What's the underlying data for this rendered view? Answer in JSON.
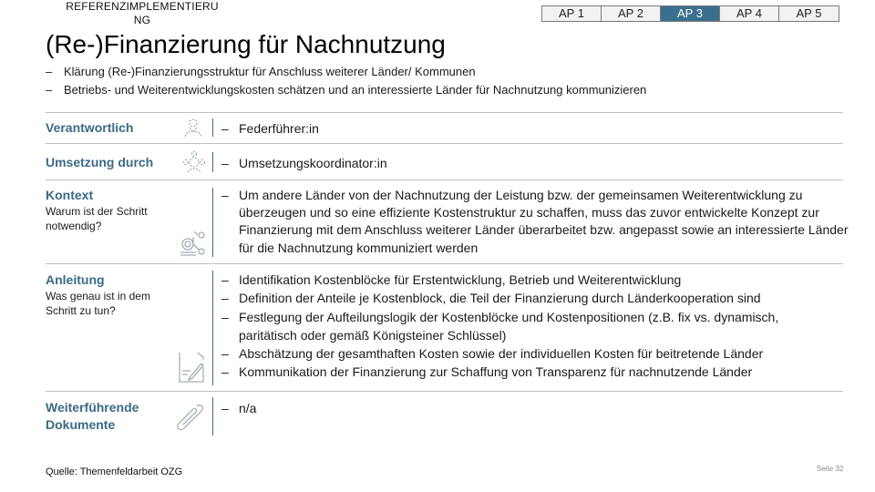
{
  "header": {
    "section": "REFERENZIMPLEMENTIERUNG",
    "section_line1": "REFERENZIMPLEMENTIERU",
    "section_line2": "NG",
    "tabs": [
      {
        "label": "AP 1",
        "active": false
      },
      {
        "label": "AP 2",
        "active": false
      },
      {
        "label": "AP 3",
        "active": true
      },
      {
        "label": "AP 4",
        "active": false
      },
      {
        "label": "AP 5",
        "active": false
      }
    ],
    "title": "(Re-)Finanzierung für Nachnutzung"
  },
  "intro": [
    "Klärung (Re-)Finanzierungsstruktur für Anschluss weiterer Länder/ Kommunen",
    "Betriebs- und Weiterentwicklungskosten schätzen und an interessierte Länder für Nachnutzung kommunizieren"
  ],
  "bullet": "–",
  "rows": {
    "verantwortlich": {
      "label": "Verantwortlich",
      "icon": "person-icon",
      "items": [
        "Federführer:in"
      ]
    },
    "umsetzung": {
      "label": "Umsetzung durch",
      "icon": "team-icon",
      "items": [
        "Umsetzungskoordinator:in"
      ]
    },
    "kontext": {
      "label": "Kontext",
      "sublabel": "Warum ist der Schritt notwendig?",
      "icon": "context-diagram-icon",
      "items": [
        "Um andere Länder von der Nachnutzung der Leistung bzw. der gemeinsamen Weiterentwicklung zu überzeugen und so eine effiziente Kostenstruktur zu schaffen, muss das zuvor entwickelte Konzept zur Finanzierung mit dem Anschluss weiterer Länder überarbeitet bzw. angepasst sowie an interessierte Länder für die Nachnutzung kommuniziert werden"
      ]
    },
    "anleitung": {
      "label": "Anleitung",
      "sublabel": "Was genau ist in dem Schritt zu tun?",
      "icon": "document-edit-icon",
      "items": [
        "Identifikation Kostenblöcke für Erstentwicklung, Betrieb und Weiterentwicklung",
        "Definition der Anteile je Kostenblock, die Teil der Finanzierung durch Länderkooperation sind",
        "Festlegung der Aufteilungslogik der Kostenblöcke und Kostenpositionen (z.B. fix vs. dynamisch, paritätisch oder gemäß Königsteiner Schlüssel)",
        "Abschätzung der gesamthaften Kosten sowie der individuellen Kosten für beitretende Länder",
        "Kommunikation der Finanzierung zur Schaffung von Transparenz für nachnutzende Länder"
      ]
    },
    "dokumente": {
      "label_line1": "Weiterführende",
      "label_line2": "Dokumente",
      "icon": "paperclip-icon",
      "items": [
        "n/a"
      ]
    }
  },
  "footer": {
    "source": "Quelle: Themenfeldarbeit OZG",
    "page": "Seite 32"
  },
  "colors": {
    "accent": "#3b6f8f",
    "label": "#3a6b85",
    "divider": "#bfbfbf"
  }
}
